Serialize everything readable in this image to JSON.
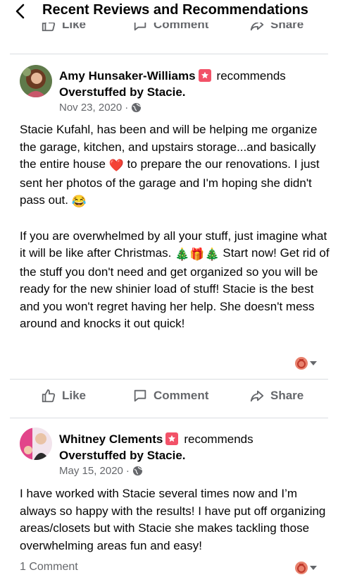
{
  "header": {
    "title": "Recent Reviews and Recommendations"
  },
  "top_actions": {
    "like": "Like",
    "comment": "Comment",
    "share": "Share"
  },
  "reviews": [
    {
      "author": "Amy Hunsaker-Williams",
      "recommends": "recommends",
      "page": "Overstuffed by Stacie.",
      "date": "Nov 23, 2020",
      "meta_sep": "·",
      "paragraphs": [
        {
          "t1": "Stacie Kufahl, has been and will be helping me organize the garage, kitchen, and upstairs storage...and basically the entire house ",
          "e1": "❤️",
          "t2": " to prepare the our renovations.  I just sent her photos of the garage and I'm hoping she didn't pass out. ",
          "e2": "😂"
        },
        {
          "t1": "If you are overwhelmed by all your stuff, just imagine what it will be like after Christmas. ",
          "e1": "🎄🎁🎄",
          "t2": " Start now!  Get rid of the stuff you don't need and get organized so you will be ready for the new shinier load of stuff!  Stacie is the best and you won't regret having her help.  She doesn't mess around and knocks it out quick!"
        }
      ],
      "actions": {
        "like": "Like",
        "comment": "Comment",
        "share": "Share"
      }
    },
    {
      "author": "Whitney Clements",
      "recommends": "recommends",
      "page": "Overstuffed by Stacie.",
      "date": "May 15, 2020",
      "meta_sep": "·",
      "text": "I have worked with Stacie several times now and I’m always so happy with the results! I have put off organizing areas/closets but with Stacie she makes tackling those overwhelming areas fun and easy!",
      "comments": "1 Comment"
    }
  ],
  "colors": {
    "accent": "#f25268",
    "muted": "#65676b",
    "divider": "#dadde1"
  }
}
